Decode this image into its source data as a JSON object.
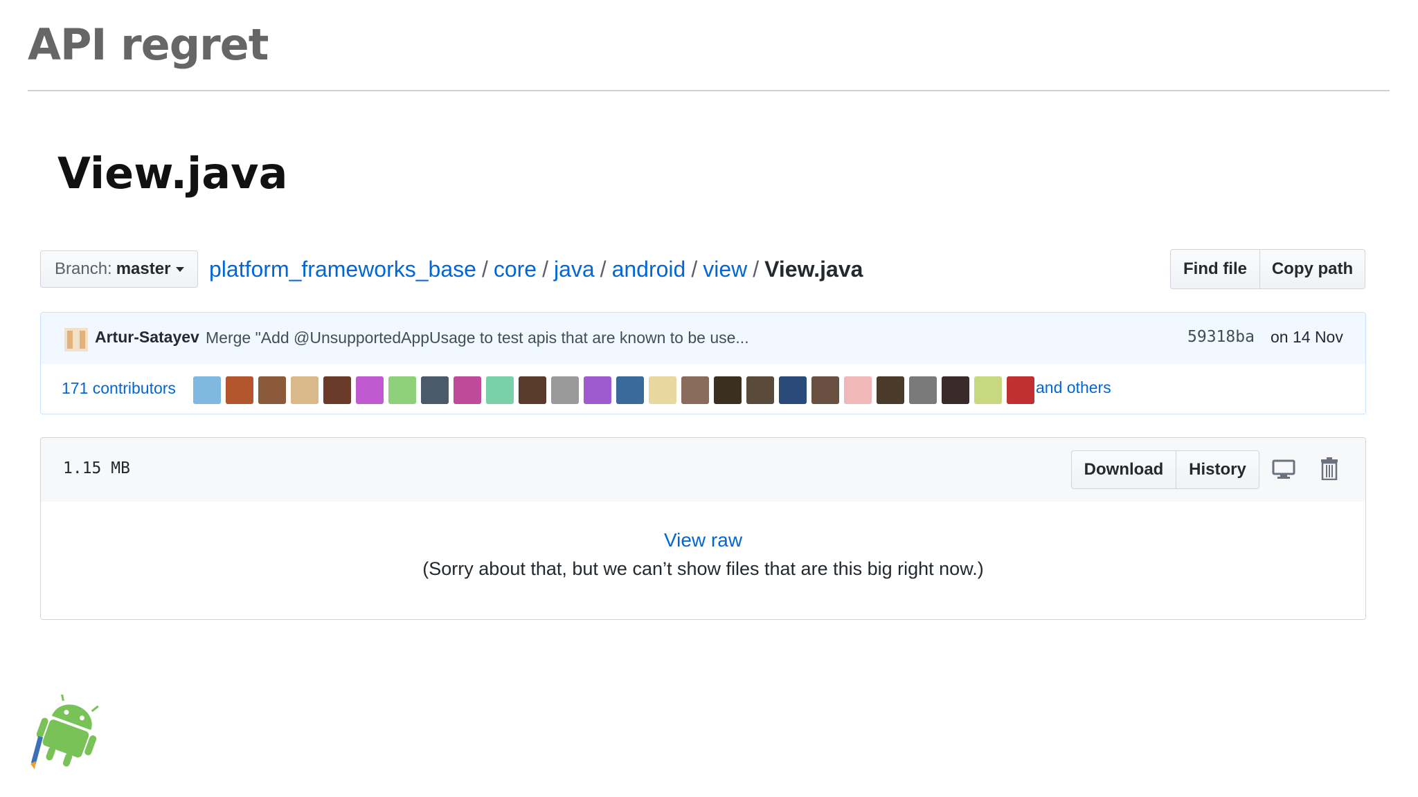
{
  "slide": {
    "title": "API regret",
    "subtitle": "View.java"
  },
  "branch": {
    "prefix": "Branch:",
    "name": "master"
  },
  "breadcrumb": {
    "parts": [
      "platform_frameworks_base",
      "core",
      "java",
      "android",
      "view"
    ],
    "separator": "/",
    "current": "View.java"
  },
  "file_nav": {
    "find_file": "Find file",
    "copy_path": "Copy path"
  },
  "commit": {
    "author": "Artur-Satayev",
    "message": "Merge \"Add @UnsupportedAppUsage to test apis that are known to be use...",
    "sha": "59318ba",
    "date": "on 14 Nov"
  },
  "contributors": {
    "count_label": "171 contributors",
    "and_others": "and others",
    "avatar_colors": [
      "#7fb8e0",
      "#b3552d",
      "#8a5a3a",
      "#d9b88a",
      "#6b3b2a",
      "#c05ad0",
      "#8fd07a",
      "#4a5a6a",
      "#c04a9a",
      "#7ad0a8",
      "#5a3a2a",
      "#9a9a9a",
      "#a05ad0",
      "#3a6a9a",
      "#e8d8a0",
      "#8a6a5a",
      "#3a3020",
      "#5a4a3a",
      "#2a4a7a",
      "#6a5040",
      "#f0b8b8",
      "#4a3a2a",
      "#7a7a7a",
      "#3a2a2a",
      "#c8d880",
      "#c03030"
    ]
  },
  "file": {
    "size": "1.15 MB",
    "download": "Download",
    "history": "History",
    "view_raw": "View raw",
    "notice": "(Sorry about that, but we can’t show files that are this big right now.)"
  },
  "colors": {
    "link": "#0366d6",
    "commit_bg": "#f1f8ff",
    "title_gray": "#666666",
    "android_green": "#78c257"
  }
}
